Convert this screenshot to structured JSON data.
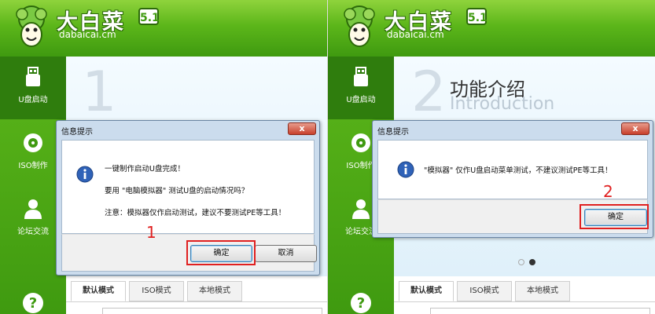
{
  "left": {
    "logo": {
      "title": "大白菜",
      "version": "5.1",
      "subtitle": "dabaicai.cm"
    },
    "sidebar": [
      {
        "label": "U盘启动",
        "icon": "usb-drive-icon"
      },
      {
        "label": "ISO制作",
        "icon": "disc-icon"
      },
      {
        "label": "论坛交流",
        "icon": "user-icon"
      }
    ],
    "help_icon": "help-icon",
    "banner_number": "1",
    "dialog": {
      "title": "信息提示",
      "close_label": "x",
      "lines": [
        "一键制作启动U盘完成！",
        "要用 \"电脑模拟器\" 测试U盘的启动情况吗？",
        "注意：模拟器仅作启动测试，建议不要测试PE等工具！"
      ],
      "ok_label": "确定",
      "cancel_label": "取消"
    },
    "step": "1",
    "tabs": [
      "默认模式",
      "ISO模式",
      "本地模式"
    ]
  },
  "right": {
    "logo": {
      "title": "大白菜",
      "version": "5.1",
      "subtitle": "dabaicai.cm"
    },
    "sidebar": [
      {
        "label": "U盘启动",
        "icon": "usb-drive-icon"
      },
      {
        "label": "ISO制作",
        "icon": "disc-icon"
      },
      {
        "label": "论坛交流",
        "icon": "user-icon"
      }
    ],
    "help_icon": "help-icon",
    "banner_number": "2",
    "feature_title": "功能介绍",
    "feature_subtitle": "Introduction",
    "dialog": {
      "title": "信息提示",
      "close_label": "x",
      "lines": [
        "\"模拟器\" 仅作U盘启动菜单测试，不建议测试PE等工具！"
      ],
      "ok_label": "确定"
    },
    "step": "2",
    "tabs": [
      "默认模式",
      "ISO模式",
      "本地模式"
    ]
  },
  "colors": {
    "brand_green": "#5cb61a",
    "highlight_red": "#e02020",
    "dialog_frame": "#cbdced"
  }
}
